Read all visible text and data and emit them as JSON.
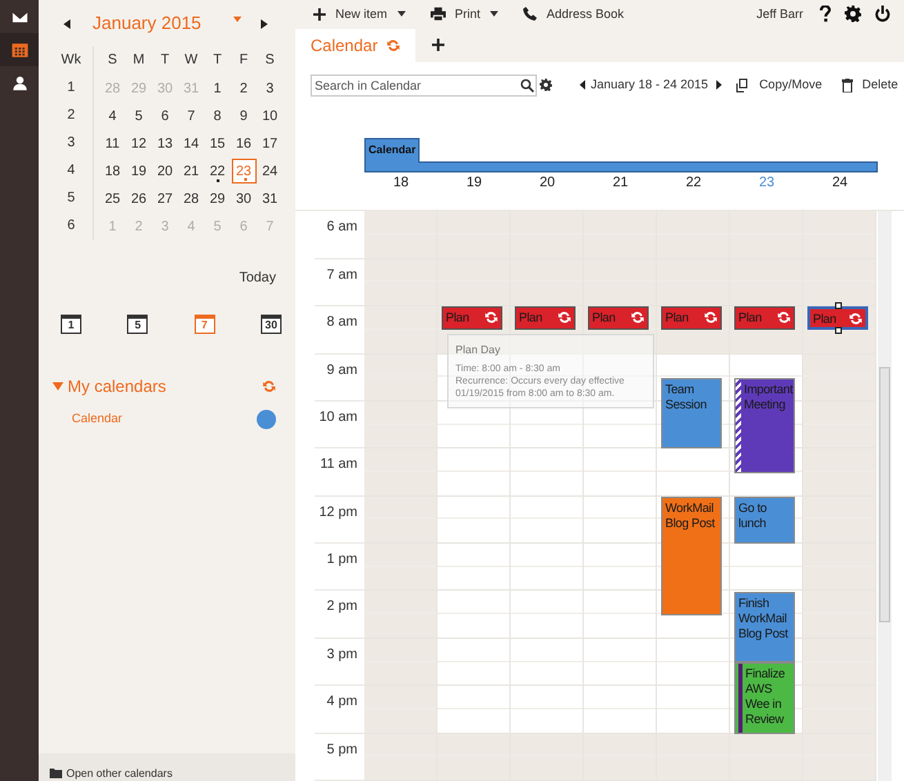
{
  "rail": [
    {
      "kind": "mail",
      "selected": false
    },
    {
      "kind": "calendar",
      "selected": true
    },
    {
      "kind": "contacts",
      "selected": false
    }
  ],
  "mini_calendar": {
    "title": "January 2015",
    "week_heading": "Wk",
    "weekdays": [
      "S",
      "M",
      "T",
      "W",
      "T",
      "F",
      "S"
    ],
    "weeks": [
      {
        "week": "1",
        "days": [
          {
            "label": "28",
            "muted": true,
            "dot": false,
            "selected": false
          },
          {
            "label": "29",
            "muted": true,
            "dot": false,
            "selected": false
          },
          {
            "label": "30",
            "muted": true,
            "dot": false,
            "selected": false
          },
          {
            "label": "31",
            "muted": true,
            "dot": false,
            "selected": false
          },
          {
            "label": "1",
            "muted": false,
            "dot": false,
            "selected": false
          },
          {
            "label": "2",
            "muted": false,
            "dot": false,
            "selected": false
          },
          {
            "label": "3",
            "muted": false,
            "dot": false,
            "selected": false
          }
        ]
      },
      {
        "week": "2",
        "days": [
          {
            "label": "4",
            "muted": false,
            "dot": false,
            "selected": false
          },
          {
            "label": "5",
            "muted": false,
            "dot": false,
            "selected": false
          },
          {
            "label": "6",
            "muted": false,
            "dot": false,
            "selected": false
          },
          {
            "label": "7",
            "muted": false,
            "dot": false,
            "selected": false
          },
          {
            "label": "8",
            "muted": false,
            "dot": false,
            "selected": false
          },
          {
            "label": "9",
            "muted": false,
            "dot": false,
            "selected": false
          },
          {
            "label": "10",
            "muted": false,
            "dot": false,
            "selected": false
          }
        ]
      },
      {
        "week": "3",
        "days": [
          {
            "label": "11",
            "muted": false,
            "dot": false,
            "selected": false
          },
          {
            "label": "12",
            "muted": false,
            "dot": false,
            "selected": false
          },
          {
            "label": "13",
            "muted": false,
            "dot": false,
            "selected": false
          },
          {
            "label": "14",
            "muted": false,
            "dot": false,
            "selected": false
          },
          {
            "label": "15",
            "muted": false,
            "dot": false,
            "selected": false
          },
          {
            "label": "16",
            "muted": false,
            "dot": false,
            "selected": false
          },
          {
            "label": "17",
            "muted": false,
            "dot": false,
            "selected": false
          }
        ]
      },
      {
        "week": "4",
        "days": [
          {
            "label": "18",
            "muted": false,
            "dot": false,
            "selected": false
          },
          {
            "label": "19",
            "muted": false,
            "dot": false,
            "selected": false
          },
          {
            "label": "20",
            "muted": false,
            "dot": false,
            "selected": false
          },
          {
            "label": "21",
            "muted": false,
            "dot": false,
            "selected": false
          },
          {
            "label": "22",
            "muted": false,
            "dot": true,
            "selected": false
          },
          {
            "label": "23",
            "muted": false,
            "dot": true,
            "selected": true
          },
          {
            "label": "24",
            "muted": false,
            "dot": false,
            "selected": false
          }
        ]
      },
      {
        "week": "5",
        "days": [
          {
            "label": "25",
            "muted": false,
            "dot": false,
            "selected": false
          },
          {
            "label": "26",
            "muted": false,
            "dot": false,
            "selected": false
          },
          {
            "label": "27",
            "muted": false,
            "dot": false,
            "selected": false
          },
          {
            "label": "28",
            "muted": false,
            "dot": false,
            "selected": false
          },
          {
            "label": "29",
            "muted": false,
            "dot": false,
            "selected": false
          },
          {
            "label": "30",
            "muted": false,
            "dot": false,
            "selected": false
          },
          {
            "label": "31",
            "muted": false,
            "dot": false,
            "selected": false
          }
        ]
      },
      {
        "week": "6",
        "days": [
          {
            "label": "1",
            "muted": true,
            "dot": false,
            "selected": false
          },
          {
            "label": "2",
            "muted": true,
            "dot": false,
            "selected": false
          },
          {
            "label": "3",
            "muted": true,
            "dot": false,
            "selected": false
          },
          {
            "label": "4",
            "muted": true,
            "dot": false,
            "selected": false
          },
          {
            "label": "5",
            "muted": true,
            "dot": false,
            "selected": false
          },
          {
            "label": "6",
            "muted": true,
            "dot": false,
            "selected": false
          },
          {
            "label": "7",
            "muted": true,
            "dot": false,
            "selected": false
          }
        ]
      }
    ]
  },
  "today_button": "Today",
  "views": [
    {
      "label": "1",
      "selected": false
    },
    {
      "label": "5",
      "selected": false
    },
    {
      "label": "7",
      "selected": true
    },
    {
      "label": "30",
      "selected": false
    }
  ],
  "my_calendars": {
    "title": "My calendars",
    "expanded": true,
    "items": [
      {
        "label": "Calendar",
        "color": "#4a8fd6"
      }
    ]
  },
  "open_other": "Open other calendars",
  "toolbar": {
    "items": [
      {
        "kind": "new",
        "label": "New item",
        "dropdown": true
      },
      {
        "kind": "print",
        "label": "Print",
        "dropdown": true
      },
      {
        "kind": "phone",
        "label": "Address Book",
        "dropdown": false
      }
    ],
    "user": "Jeff Barr"
  },
  "tabs": [
    {
      "label": "Calendar",
      "selected": true
    }
  ],
  "search": {
    "placeholder": "Search in Calendar"
  },
  "range": "January 18 - 24 2015",
  "actions": [
    {
      "kind": "copy",
      "label": "Copy/Move"
    },
    {
      "kind": "delete",
      "label": "Delete"
    }
  ],
  "all_day": {
    "label": "Calendar"
  },
  "hours": [
    {
      "label": "6 am",
      "off": true
    },
    {
      "label": "7 am",
      "off": true
    },
    {
      "label": "8 am",
      "off": true
    },
    {
      "label": "9 am",
      "off": false
    },
    {
      "label": "10 am",
      "off": false
    },
    {
      "label": "11 am",
      "off": false
    },
    {
      "label": "12 pm",
      "off": false
    },
    {
      "label": "1 pm",
      "off": false
    },
    {
      "label": "2 pm",
      "off": false
    },
    {
      "label": "3 pm",
      "off": false
    },
    {
      "label": "4 pm",
      "off": false
    },
    {
      "label": "5 pm",
      "off": true
    }
  ],
  "days": [
    {
      "label": "18",
      "today": false,
      "weekend": true
    },
    {
      "label": "19",
      "today": false,
      "weekend": false,
      "events": [
        {
          "title": "Plan",
          "color": "#d9222a",
          "recurring": true,
          "selected": false
        }
      ]
    },
    {
      "label": "20",
      "today": false,
      "weekend": false,
      "events": [
        {
          "title": "Plan",
          "color": "#d9222a",
          "recurring": true,
          "selected": false
        }
      ]
    },
    {
      "label": "21",
      "today": false,
      "weekend": false,
      "events": [
        {
          "title": "Plan",
          "color": "#d9222a",
          "recurring": true,
          "selected": false
        }
      ]
    },
    {
      "label": "22",
      "today": false,
      "weekend": false,
      "events": [
        {
          "title": "Plan",
          "color": "#d9222a",
          "recurring": true,
          "selected": false
        },
        {
          "title": "Team Session",
          "color": "#4a8fd6",
          "recurring": false,
          "selected": false
        },
        {
          "title": "WorkMail Blog Post",
          "color": "#f07018",
          "recurring": false,
          "selected": false
        }
      ]
    },
    {
      "label": "23",
      "today": true,
      "weekend": false,
      "events": [
        {
          "title": "Plan",
          "color": "#d9222a",
          "recurring": true,
          "selected": false
        },
        {
          "title": "Important Meeting",
          "color": "#5f3ab8",
          "recurring": false,
          "selected": false,
          "tentative": true
        },
        {
          "title": "Go to lunch",
          "color": "#4a8fd6",
          "recurring": false,
          "selected": false
        },
        {
          "title": "Finish WorkMail Blog Post",
          "color": "#4a8fd6",
          "recurring": false,
          "selected": false
        },
        {
          "title": "Finalize AWS Wee in Review",
          "color": "#4cb944",
          "recurring": false,
          "selected": false,
          "flagged": true
        }
      ]
    },
    {
      "label": "24",
      "today": false,
      "weekend": true,
      "events": [
        {
          "title": "Plan",
          "color": "#d9222a",
          "recurring": true,
          "selected": true
        }
      ]
    }
  ],
  "tooltip": {
    "title": "Plan Day",
    "lines": [
      "Time: 8:00 am - 8:30 am",
      "Recurrence: Occurs every day effective 01/19/2015 from 8:00 am to 8:30 am."
    ]
  }
}
